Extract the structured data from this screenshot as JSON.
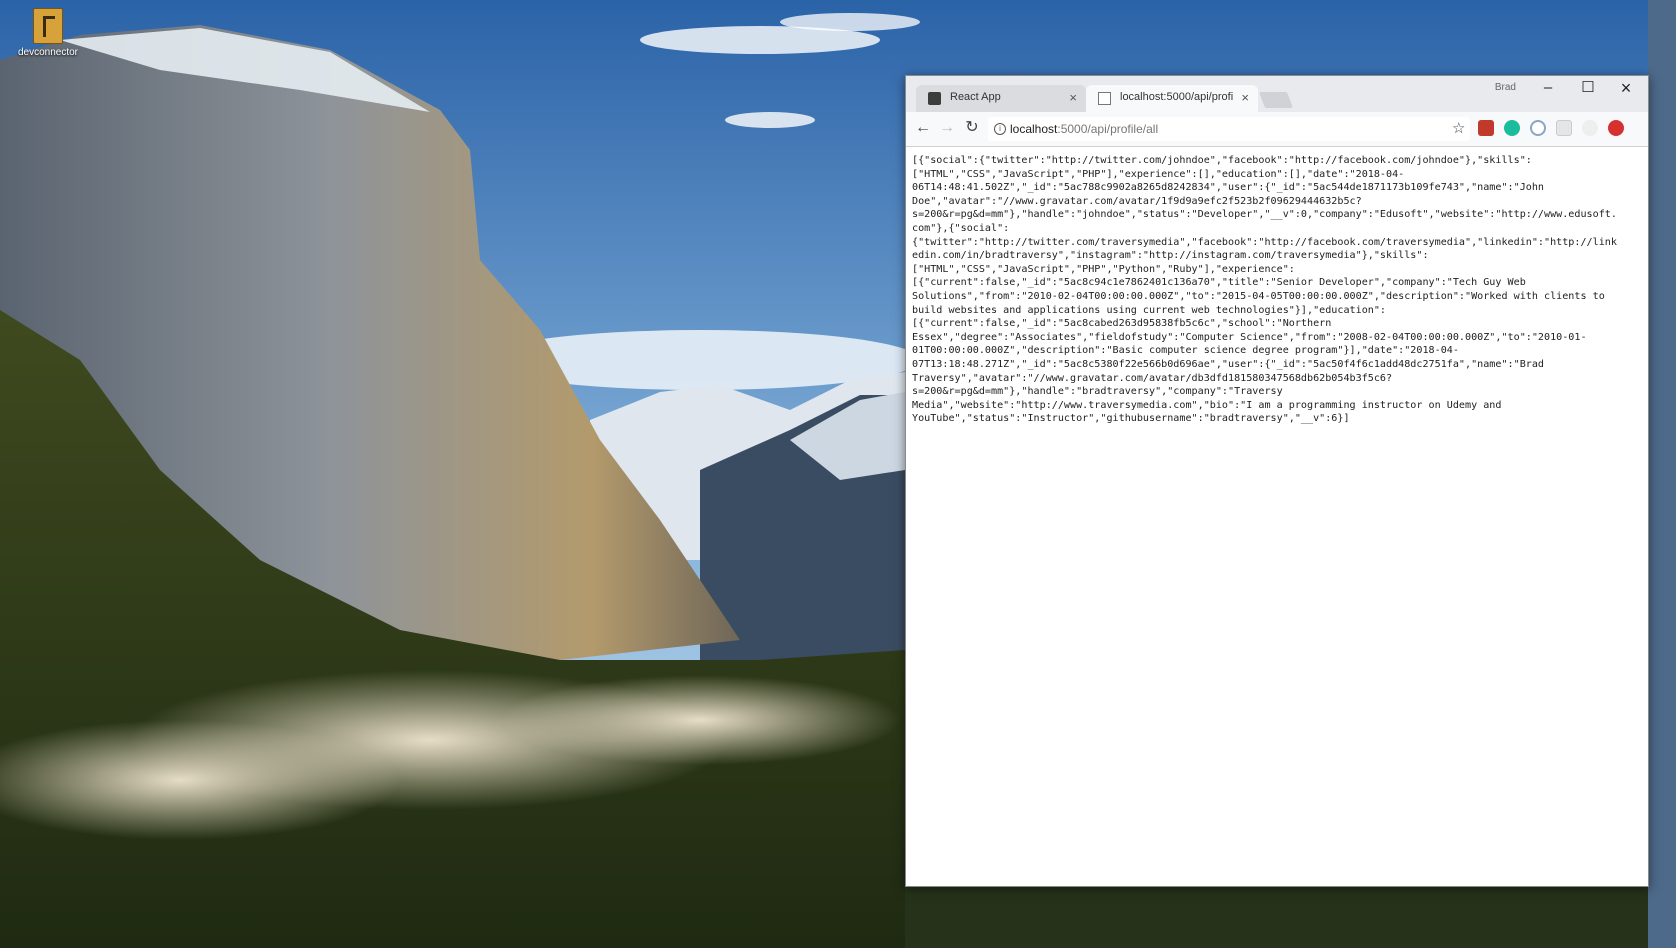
{
  "desktop": {
    "icon_label": "devconnector"
  },
  "browser": {
    "profile_name": "Brad",
    "tabs": [
      {
        "title": "React App",
        "active": false
      },
      {
        "title": "localhost:5000/api/profi",
        "active": true
      }
    ],
    "url_host": "localhost",
    "url_path": ":5000/api/profile/all",
    "response_lines": [
      "[{\"social\":{\"twitter\":\"http://twitter.com/johndoe\",\"facebook\":\"http://facebook.com/johndoe\"},\"skills\":",
      "[\"HTML\",\"CSS\",\"JavaScript\",\"PHP\"],\"experience\":[],\"education\":[],\"date\":\"2018-04-",
      "06T14:48:41.502Z\",\"_id\":\"5ac788c9902a8265d8242834\",\"user\":{\"_id\":\"5ac544de1871173b109fe743\",\"name\":\"John",
      "Doe\",\"avatar\":\"//www.gravatar.com/avatar/1f9d9a9efc2f523b2f09629444632b5c?",
      "s=200&r=pg&d=mm\"},\"handle\":\"johndoe\",\"status\":\"Developer\",\"__v\":0,\"company\":\"Edusoft\",\"website\":\"http://www.edusoft.",
      "com\"},{\"social\":",
      "{\"twitter\":\"http://twitter.com/traversymedia\",\"facebook\":\"http://facebook.com/traversymedia\",\"linkedin\":\"http://link",
      "edin.com/in/bradtraversy\",\"instagram\":\"http://instagram.com/traversymedia\"},\"skills\":",
      "[\"HTML\",\"CSS\",\"JavaScript\",\"PHP\",\"Python\",\"Ruby\"],\"experience\":",
      "[{\"current\":false,\"_id\":\"5ac8c94c1e7862401c136a70\",\"title\":\"Senior Developer\",\"company\":\"Tech Guy Web",
      "Solutions\",\"from\":\"2010-02-04T00:00:00.000Z\",\"to\":\"2015-04-05T00:00:00.000Z\",\"description\":\"Worked with clients to",
      "build websites and applications using current web technologies\"}],\"education\":",
      "[{\"current\":false,\"_id\":\"5ac8cabed263d95838fb5c6c\",\"school\":\"Northern",
      "Essex\",\"degree\":\"Associates\",\"fieldofstudy\":\"Computer Science\",\"from\":\"2008-02-04T00:00:00.000Z\",\"to\":\"2010-01-",
      "01T00:00:00.000Z\",\"description\":\"Basic computer science degree program\"}],\"date\":\"2018-04-",
      "07T13:18:48.271Z\",\"_id\":\"5ac8c5380f22e566b0d696ae\",\"user\":{\"_id\":\"5ac50f4f6c1add48dc2751fa\",\"name\":\"Brad",
      "Traversy\",\"avatar\":\"//www.gravatar.com/avatar/db3dfd181580347568db62b054b3f5c6?",
      "s=200&r=pg&d=mm\"},\"handle\":\"bradtraversy\",\"company\":\"Traversy",
      "Media\",\"website\":\"http://www.traversymedia.com\",\"bio\":\"I am a programming instructor on Udemy and",
      "YouTube\",\"status\":\"Instructor\",\"githubusername\":\"bradtraversy\",\"__v\":6}]"
    ]
  },
  "colors": {
    "titlebar": "#e8eaed",
    "toolbar": "#f8f9fa",
    "url_path": "#777777"
  }
}
